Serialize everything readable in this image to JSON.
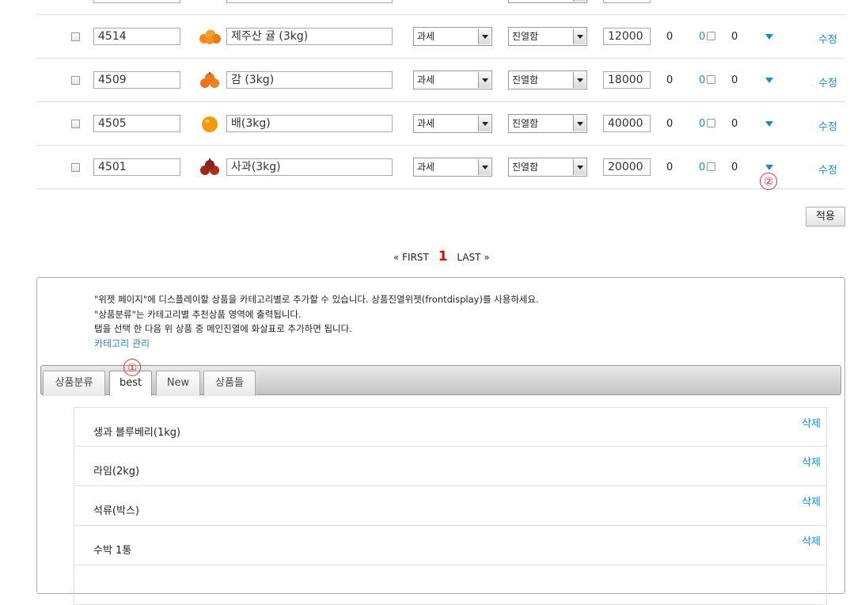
{
  "products": [
    {
      "code": "",
      "name": "",
      "tax": "",
      "display": "",
      "price": "",
      "c1": "",
      "c2": "",
      "c3": "",
      "edit": "",
      "partial": true
    },
    {
      "code": "4514",
      "name": "제주산 귤 (3kg)",
      "tax": "과세",
      "display": "진열함",
      "price": "12000",
      "c1": "0",
      "c2": "0",
      "c3": "0",
      "edit": "수정"
    },
    {
      "code": "4509",
      "name": "감 (3kg)",
      "tax": "과세",
      "display": "진열함",
      "price": "18000",
      "c1": "0",
      "c2": "0",
      "c3": "0",
      "edit": "수정"
    },
    {
      "code": "4505",
      "name": "배(3kg)",
      "tax": "과세",
      "display": "진열함",
      "price": "40000",
      "c1": "0",
      "c2": "0",
      "c3": "0",
      "edit": "수정"
    },
    {
      "code": "4501",
      "name": "사과(3kg)",
      "tax": "과세",
      "display": "진열함",
      "price": "20000",
      "c1": "0",
      "c2": "0",
      "c3": "0",
      "edit": "수정"
    }
  ],
  "apply_label": "적용",
  "pager": {
    "first": "« FIRST",
    "current": "1",
    "last": "LAST »"
  },
  "annotations": {
    "one": "①",
    "two": "②"
  },
  "help": {
    "line1": "\"위젯 페이지\"에 디스플레이할 상품을 카테고리별로 추가할 수 있습니다. 상품진열위젯(frontdisplay)를 사용하세요.",
    "line2": "\"상품분류\"는 카테고리별 추천상품 영역에 출력됩니다.",
    "line3": "탭을 선택 한 다음 위 상품 중 메인진열에 화살표로 추가하면 됩니다.",
    "link": "카테고리 관리"
  },
  "tabs": [
    "상품분류",
    "best",
    "New",
    "상품들"
  ],
  "active_tab": "best",
  "list_items": [
    {
      "name": "생과 블루베리(1kg)",
      "del": "삭제"
    },
    {
      "name": "라임(2kg)",
      "del": "삭제"
    },
    {
      "name": "석류(박스)",
      "del": "삭제"
    },
    {
      "name": "수박 1통",
      "del": "삭제"
    },
    {
      "name": "",
      "del": ""
    }
  ],
  "colors": {
    "link": "#1a8bc9",
    "annotation": "#dd3333"
  },
  "icons": [
    "checkbox-icon",
    "fruit-thumbnail-icon",
    "dropdown-arrow-icon",
    "share-icon",
    "move-down-triangle-icon"
  ]
}
